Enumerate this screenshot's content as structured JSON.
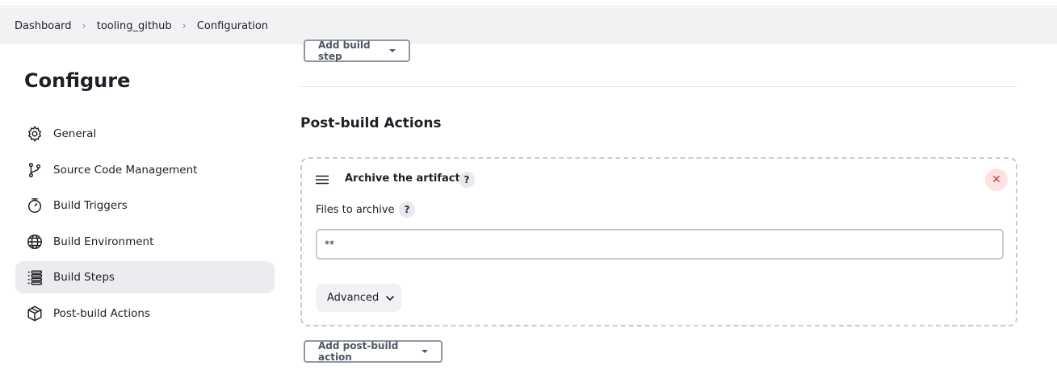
{
  "breadcrumb": {
    "items": [
      "Dashboard",
      "tooling_github",
      "Configuration"
    ]
  },
  "sidebar": {
    "title": "Configure",
    "items": [
      {
        "label": "General",
        "icon": "gear-icon"
      },
      {
        "label": "Source Code Management",
        "icon": "git-branch-icon"
      },
      {
        "label": "Build Triggers",
        "icon": "timer-icon"
      },
      {
        "label": "Build Environment",
        "icon": "globe-icon"
      },
      {
        "label": "Build Steps",
        "icon": "list-icon",
        "active": true
      },
      {
        "label": "Post-build Actions",
        "icon": "package-icon"
      }
    ]
  },
  "main": {
    "add_build_step_label": "Add build step",
    "section_title": "Post-build Actions",
    "card": {
      "title": "Archive the artifacts",
      "help_label": "?",
      "field_label": "Files to archive",
      "field_value": "**",
      "advanced_label": "Advanced",
      "close_label": "✕"
    },
    "add_post_build_label": "Add post-build action"
  },
  "colors": {
    "active_nav_bg": "#ebebf0",
    "close_bg": "#fbe3e4",
    "close_fg": "#d6303c"
  }
}
